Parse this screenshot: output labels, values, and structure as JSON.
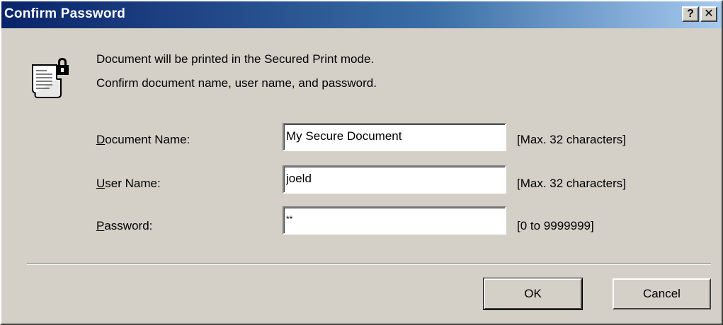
{
  "window": {
    "title": "Confirm Password",
    "help_label": "?",
    "close_label": "✕"
  },
  "message": {
    "line1": "Document will be printed in the Secured Print mode.",
    "line2": "Confirm document name, user name, and password."
  },
  "fields": {
    "document_name": {
      "label_hotkey": "D",
      "label_rest": "ocument Name:",
      "value": "My Secure Document",
      "hint": "[Max. 32 characters]"
    },
    "user_name": {
      "label_hotkey": "U",
      "label_rest": "ser Name:",
      "value": "joeld",
      "hint": "[Max. 32 characters]"
    },
    "password": {
      "label_hotkey": "P",
      "label_rest": "assword:",
      "value": "**",
      "hint": "[0 to 9999999]"
    }
  },
  "buttons": {
    "ok": "OK",
    "cancel": "Cancel"
  },
  "icons": {
    "document": "document-lock-icon"
  }
}
